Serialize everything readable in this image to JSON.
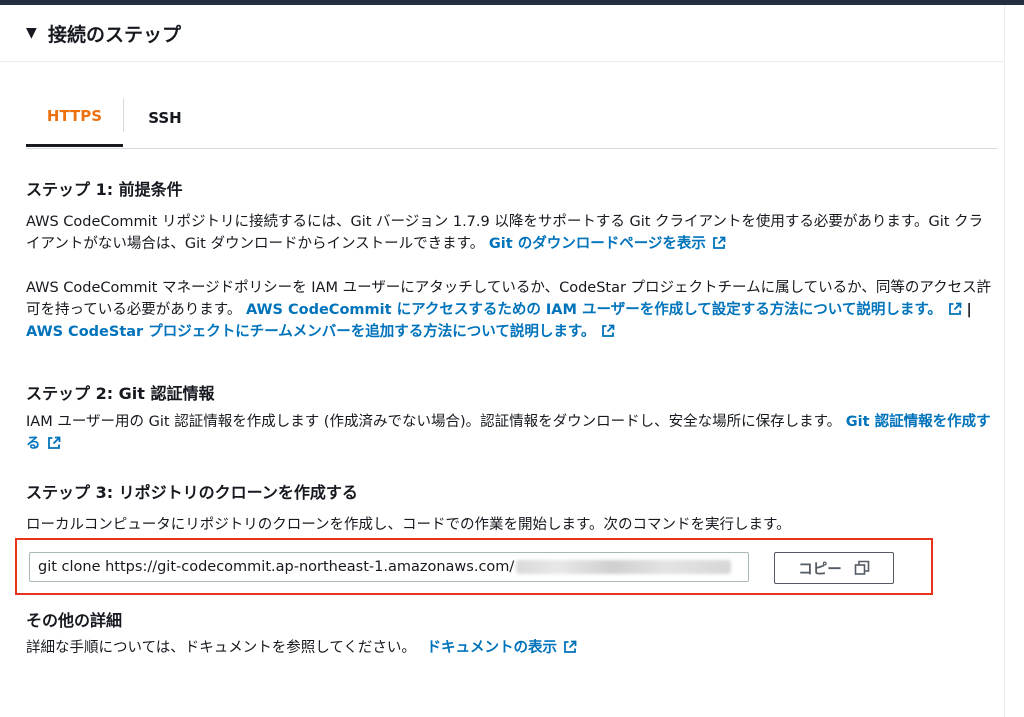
{
  "section": {
    "caret": "▼",
    "title": "接続のステップ"
  },
  "tabs": [
    {
      "label": "HTTPS",
      "active": true
    },
    {
      "label": "SSH",
      "active": false
    }
  ],
  "step1": {
    "heading": "ステップ 1: 前提条件",
    "para1_text": "AWS CodeCommit リポジトリに接続するには、Git バージョン 1.7.9 以降をサポートする Git クライアントを使用する必要があります。Git クライアントがない場合は、Git ダウンロードからインストールできます。",
    "para1_link": "Git のダウンロードページを表示",
    "para2_text": "AWS CodeCommit マネージドポリシーを IAM ユーザーにアタッチしているか、CodeStar プロジェクトチームに属しているか、同等のアクセス許可を持っている必要があります。",
    "para2_link1": "AWS CodeCommit にアクセスするための IAM ユーザーを作成して設定する方法について説明します。",
    "para2_sep": "|",
    "para2_link2": "AWS CodeStar プロジェクトにチームメンバーを追加する方法について説明します。"
  },
  "step2": {
    "heading": "ステップ 2: Git 認証情報",
    "text": "IAM ユーザー用の Git 認証情報を作成します (作成済みでない場合)。認証情報をダウンロードし、安全な場所に保存します。",
    "link": "Git 認証情報を作成する"
  },
  "step3": {
    "heading": "ステップ 3: リポジトリのクローンを作成する",
    "text": "ローカルコンピュータにリポジトリのクローンを作成し、コードでの作業を開始します。次のコマンドを実行します。",
    "command": "git clone https://git-codecommit.ap-northeast-1.amazonaws.com/",
    "copy_label": "コピー"
  },
  "other": {
    "heading": "その他の詳細",
    "text": "詳細な手順については、ドキュメントを参照してください。",
    "link": "ドキュメントの表示"
  },
  "colors": {
    "accent": "#ec7211",
    "link": "#0073bb",
    "highlight": "#e8341c",
    "header": "#232f3e"
  },
  "icons": [
    "caret-down-icon",
    "external-link-icon",
    "copy-icon"
  ]
}
